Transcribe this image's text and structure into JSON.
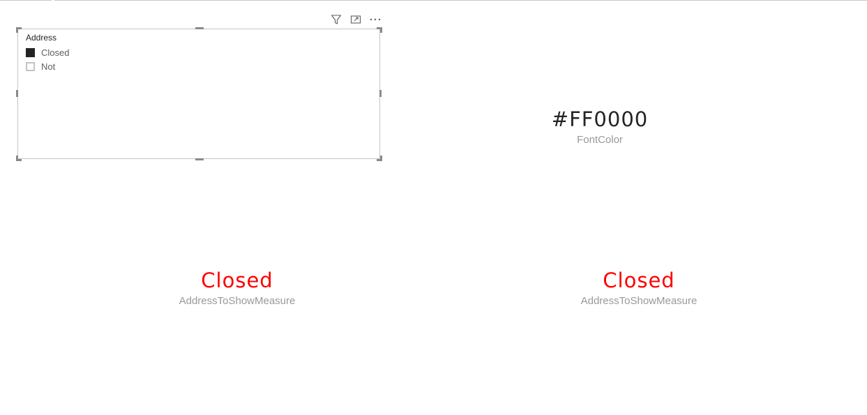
{
  "slicer": {
    "header": "Address",
    "items": [
      {
        "label": "Closed",
        "checked": true
      },
      {
        "label": "Not",
        "checked": false
      }
    ]
  },
  "toolbar": {
    "icons": [
      "filter-icon",
      "focus-mode-icon",
      "more-options-icon"
    ]
  },
  "cards": {
    "font_color": {
      "value": "#FF0000",
      "label": "FontColor",
      "value_color": "#252423"
    },
    "address_left": {
      "value": "Closed",
      "label": "AddressToShowMeasure",
      "value_color": "#FF0000"
    },
    "address_right": {
      "value": "Closed",
      "label": "AddressToShowMeasure",
      "value_color": "#FF0000"
    }
  },
  "colors": {
    "accent_red": "#FF0000",
    "label_gray": "#999999",
    "text_dark": "#252423"
  }
}
